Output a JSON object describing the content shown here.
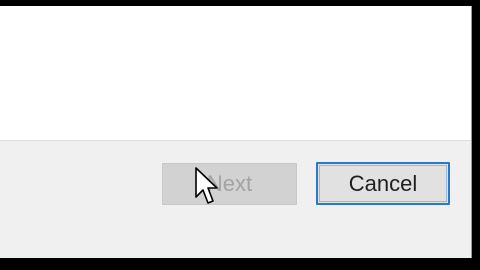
{
  "dialog": {
    "buttons": {
      "next_label": "Next",
      "cancel_label": "Cancel"
    }
  },
  "state": {
    "next_enabled": false,
    "cancel_focused": true
  },
  "colors": {
    "focus_border": "#2979c8",
    "disabled_text": "#a3a3a3",
    "dialog_bg": "#f0f0f0",
    "content_bg": "#ffffff"
  },
  "cursor": {
    "icon": "arrow-cursor-icon"
  }
}
